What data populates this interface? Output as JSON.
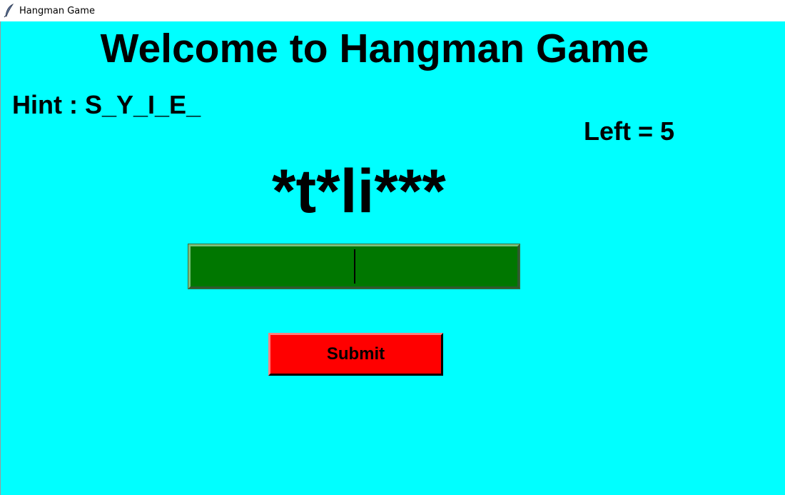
{
  "window": {
    "title": "Hangman Game",
    "icon": "feather-icon"
  },
  "game": {
    "heading": "Welcome to Hangman Game",
    "hint": "Hint : S_Y_I_E_",
    "left": "Left = 5",
    "masked_word": "*t*li***",
    "guess_input": {
      "value": ""
    },
    "submit_label": "Submit"
  },
  "colors": {
    "background": "#00ffff",
    "input_background": "#007700",
    "button_background": "#ff0000"
  }
}
